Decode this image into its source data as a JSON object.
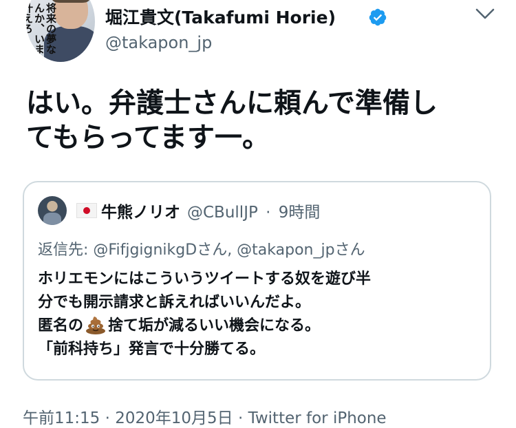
{
  "author": {
    "display_name": "堀江貴文(Takafumi Horie)",
    "handle": "@takapon_jp",
    "avatar_cover_text": "将来の夢なんか、いま叶えろ"
  },
  "tweet": {
    "text_line1": "はい。弁護士さんに頼んで準備し",
    "text_line2": "てもらってます一。"
  },
  "quoted_tweet": {
    "name": "牛熊ノリオ",
    "handle": "@CBullJP",
    "separator": "·",
    "time": "9時間",
    "reply_label": "返信先:",
    "reply_to": "@FifjgignikgDさん, @takapon_jpさん",
    "line1": "ホリエモンにはこういうツイートする奴を遊び半",
    "line2": "分でも開示請求と訴えればいいんだよ。",
    "line3_before_emoji": "匿名の",
    "line3_after_emoji": "捨て垢が減るいい機会になる。",
    "line4": "「前科持ち」発言で十分勝てる。"
  },
  "footer": {
    "time": "午前11:15",
    "separator": "·",
    "date": "2020年10月5日",
    "source": "Twitter for iPhone"
  },
  "icons": {
    "verified": "verified-badge-icon",
    "caret": "chevron-down-icon",
    "flag": "japan-flag-icon",
    "poop": "pile-of-poo-icon"
  },
  "colors": {
    "verified_blue": "#1d9bf0",
    "secondary_text": "#536471",
    "border": "#cfd9de"
  }
}
